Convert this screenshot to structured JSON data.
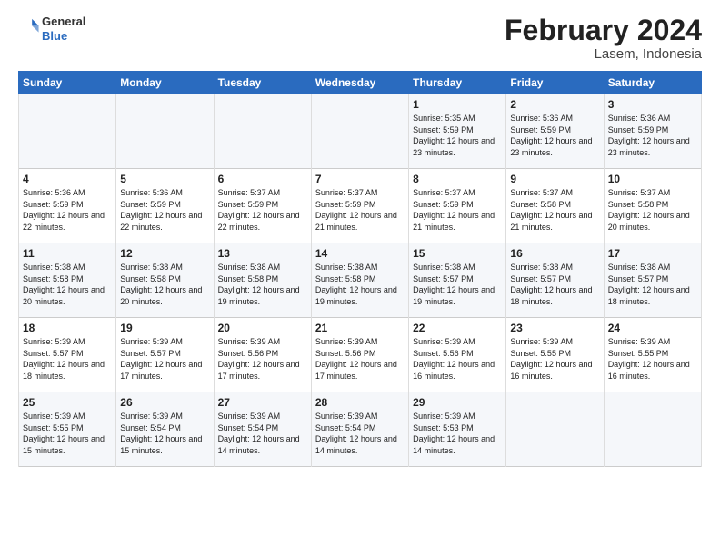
{
  "header": {
    "logo": {
      "general": "General",
      "blue": "Blue"
    },
    "title": "February 2024",
    "subtitle": "Lasem, Indonesia"
  },
  "weekdays": [
    "Sunday",
    "Monday",
    "Tuesday",
    "Wednesday",
    "Thursday",
    "Friday",
    "Saturday"
  ],
  "weeks": [
    [
      {
        "day": "",
        "info": ""
      },
      {
        "day": "",
        "info": ""
      },
      {
        "day": "",
        "info": ""
      },
      {
        "day": "",
        "info": ""
      },
      {
        "day": "1",
        "sunrise": "5:35 AM",
        "sunset": "5:59 PM",
        "daylight": "12 hours and 23 minutes."
      },
      {
        "day": "2",
        "sunrise": "5:36 AM",
        "sunset": "5:59 PM",
        "daylight": "12 hours and 23 minutes."
      },
      {
        "day": "3",
        "sunrise": "5:36 AM",
        "sunset": "5:59 PM",
        "daylight": "12 hours and 23 minutes."
      }
    ],
    [
      {
        "day": "4",
        "sunrise": "5:36 AM",
        "sunset": "5:59 PM",
        "daylight": "12 hours and 22 minutes."
      },
      {
        "day": "5",
        "sunrise": "5:36 AM",
        "sunset": "5:59 PM",
        "daylight": "12 hours and 22 minutes."
      },
      {
        "day": "6",
        "sunrise": "5:37 AM",
        "sunset": "5:59 PM",
        "daylight": "12 hours and 22 minutes."
      },
      {
        "day": "7",
        "sunrise": "5:37 AM",
        "sunset": "5:59 PM",
        "daylight": "12 hours and 21 minutes."
      },
      {
        "day": "8",
        "sunrise": "5:37 AM",
        "sunset": "5:59 PM",
        "daylight": "12 hours and 21 minutes."
      },
      {
        "day": "9",
        "sunrise": "5:37 AM",
        "sunset": "5:58 PM",
        "daylight": "12 hours and 21 minutes."
      },
      {
        "day": "10",
        "sunrise": "5:37 AM",
        "sunset": "5:58 PM",
        "daylight": "12 hours and 20 minutes."
      }
    ],
    [
      {
        "day": "11",
        "sunrise": "5:38 AM",
        "sunset": "5:58 PM",
        "daylight": "12 hours and 20 minutes."
      },
      {
        "day": "12",
        "sunrise": "5:38 AM",
        "sunset": "5:58 PM",
        "daylight": "12 hours and 20 minutes."
      },
      {
        "day": "13",
        "sunrise": "5:38 AM",
        "sunset": "5:58 PM",
        "daylight": "12 hours and 19 minutes."
      },
      {
        "day": "14",
        "sunrise": "5:38 AM",
        "sunset": "5:58 PM",
        "daylight": "12 hours and 19 minutes."
      },
      {
        "day": "15",
        "sunrise": "5:38 AM",
        "sunset": "5:57 PM",
        "daylight": "12 hours and 19 minutes."
      },
      {
        "day": "16",
        "sunrise": "5:38 AM",
        "sunset": "5:57 PM",
        "daylight": "12 hours and 18 minutes."
      },
      {
        "day": "17",
        "sunrise": "5:38 AM",
        "sunset": "5:57 PM",
        "daylight": "12 hours and 18 minutes."
      }
    ],
    [
      {
        "day": "18",
        "sunrise": "5:39 AM",
        "sunset": "5:57 PM",
        "daylight": "12 hours and 18 minutes."
      },
      {
        "day": "19",
        "sunrise": "5:39 AM",
        "sunset": "5:57 PM",
        "daylight": "12 hours and 17 minutes."
      },
      {
        "day": "20",
        "sunrise": "5:39 AM",
        "sunset": "5:56 PM",
        "daylight": "12 hours and 17 minutes."
      },
      {
        "day": "21",
        "sunrise": "5:39 AM",
        "sunset": "5:56 PM",
        "daylight": "12 hours and 17 minutes."
      },
      {
        "day": "22",
        "sunrise": "5:39 AM",
        "sunset": "5:56 PM",
        "daylight": "12 hours and 16 minutes."
      },
      {
        "day": "23",
        "sunrise": "5:39 AM",
        "sunset": "5:55 PM",
        "daylight": "12 hours and 16 minutes."
      },
      {
        "day": "24",
        "sunrise": "5:39 AM",
        "sunset": "5:55 PM",
        "daylight": "12 hours and 16 minutes."
      }
    ],
    [
      {
        "day": "25",
        "sunrise": "5:39 AM",
        "sunset": "5:55 PM",
        "daylight": "12 hours and 15 minutes."
      },
      {
        "day": "26",
        "sunrise": "5:39 AM",
        "sunset": "5:54 PM",
        "daylight": "12 hours and 15 minutes."
      },
      {
        "day": "27",
        "sunrise": "5:39 AM",
        "sunset": "5:54 PM",
        "daylight": "12 hours and 14 minutes."
      },
      {
        "day": "28",
        "sunrise": "5:39 AM",
        "sunset": "5:54 PM",
        "daylight": "12 hours and 14 minutes."
      },
      {
        "day": "29",
        "sunrise": "5:39 AM",
        "sunset": "5:53 PM",
        "daylight": "12 hours and 14 minutes."
      },
      {
        "day": "",
        "info": ""
      },
      {
        "day": "",
        "info": ""
      }
    ]
  ],
  "labels": {
    "sunrise": "Sunrise:",
    "sunset": "Sunset:",
    "daylight": "Daylight:"
  }
}
